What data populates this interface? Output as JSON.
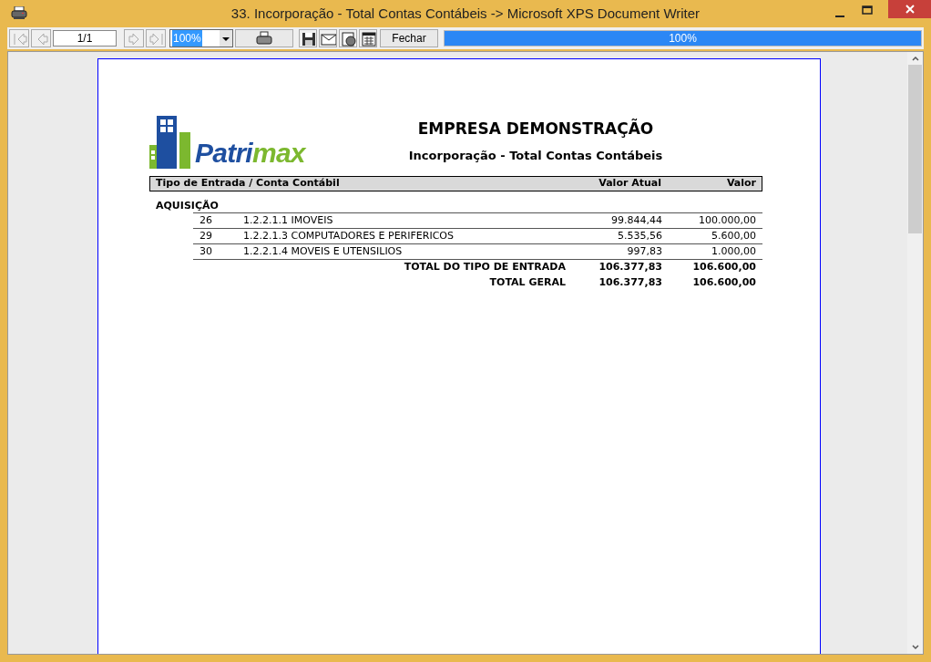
{
  "window": {
    "title": "33. Incorporação - Total Contas Contábeis -> Microsoft XPS Document Writer"
  },
  "toolbar": {
    "page_field": "1/1",
    "zoom": "100%",
    "close_button": "Fechar",
    "progress": {
      "level": 1.0,
      "reading": "100%"
    }
  },
  "report": {
    "logo_parts": [
      "Patri",
      "max"
    ],
    "company": "EMPRESA DEMONSTRAÇÃO",
    "title": "Incorporação - Total Contas Contábeis",
    "columns": [
      "Tipo de Entrada / Conta Contábil",
      "Valor Atual",
      "Valor"
    ],
    "group": "AQUISIÇÃO",
    "rows": [
      {
        "code": "26",
        "account": "1.2.2.1.1 IMOVEIS",
        "current": "99.844,44",
        "value": "100.000,00"
      },
      {
        "code": "29",
        "account": "1.2.2.1.3 COMPUTADORES E PERIFERICOS",
        "current": "5.535,56",
        "value": "5.600,00"
      },
      {
        "code": "30",
        "account": "1.2.2.1.4 MOVEIS E UTENSILIOS",
        "current": "997,83",
        "value": "1.000,00"
      }
    ],
    "totals": [
      {
        "label": "TOTAL DO TIPO DE ENTRADA",
        "current": "106.377,83",
        "value": "106.600,00"
      },
      {
        "label": "TOTAL GERAL",
        "current": "106.377,83",
        "value": "106.600,00"
      }
    ]
  }
}
